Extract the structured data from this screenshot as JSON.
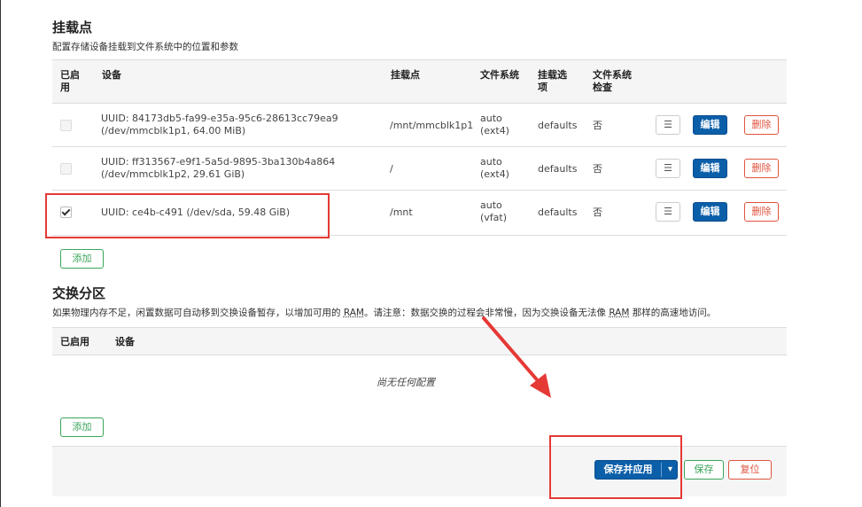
{
  "mount": {
    "title": "挂载点",
    "description": "配置存储设备挂载到文件系统中的位置和参数",
    "headers": {
      "enabled": "已启用",
      "device": "设备",
      "mountpoint": "挂载点",
      "fs": "文件系统",
      "options": "挂载选项",
      "fsck": "文件系统检查"
    },
    "rows": [
      {
        "enabled": false,
        "device_line1": "UUID: 84173db5-fa99-e35a-95c6-28613cc79ea9",
        "device_line2": "(/dev/mmcblk1p1, 64.00 MiB)",
        "mountpoint": "/mnt/mmcblk1p1",
        "fs_line1": "auto",
        "fs_line2": "(ext4)",
        "options": "defaults",
        "fsck": "否"
      },
      {
        "enabled": false,
        "device_line1": "UUID: ff313567-e9f1-5a5d-9895-3ba130b4a864",
        "device_line2": "(/dev/mmcblk1p2, 29.61 GiB)",
        "mountpoint": "/",
        "fs_line1": "auto",
        "fs_line2": "(ext4)",
        "options": "defaults",
        "fsck": "否"
      },
      {
        "enabled": true,
        "device_line1": "UUID: ce4b-c491 (/dev/sda, 59.48 GiB)",
        "device_line2": "",
        "mountpoint": "/mnt",
        "fs_line1": "auto",
        "fs_line2": "(vfat)",
        "options": "defaults",
        "fsck": "否"
      }
    ],
    "menu_glyph": "☰",
    "edit_label": "编辑",
    "delete_label": "删除",
    "add_label": "添加"
  },
  "swap": {
    "title": "交换分区",
    "description_pre": "如果物理内存不足，闲置数据可自动移到交换设备暂存，以增加可用的 ",
    "ram1": "RAM",
    "description_mid": "。请注意：数据交换的过程会非常慢，因为交换设备无法像 ",
    "ram2": "RAM",
    "description_post": " 那样的高速地访问。",
    "headers": {
      "enabled": "已启用",
      "device": "设备"
    },
    "empty": "尚无任何配置",
    "add_label": "添加"
  },
  "footer": {
    "save_apply_label": "保存并应用",
    "dropdown_glyph": "▾",
    "save_label": "保存",
    "reset_label": "复位"
  },
  "colors": {
    "primary": "#0b5ea8",
    "positive": "#3aa55a",
    "negative": "#e0533e",
    "annotation": "#e53935"
  }
}
